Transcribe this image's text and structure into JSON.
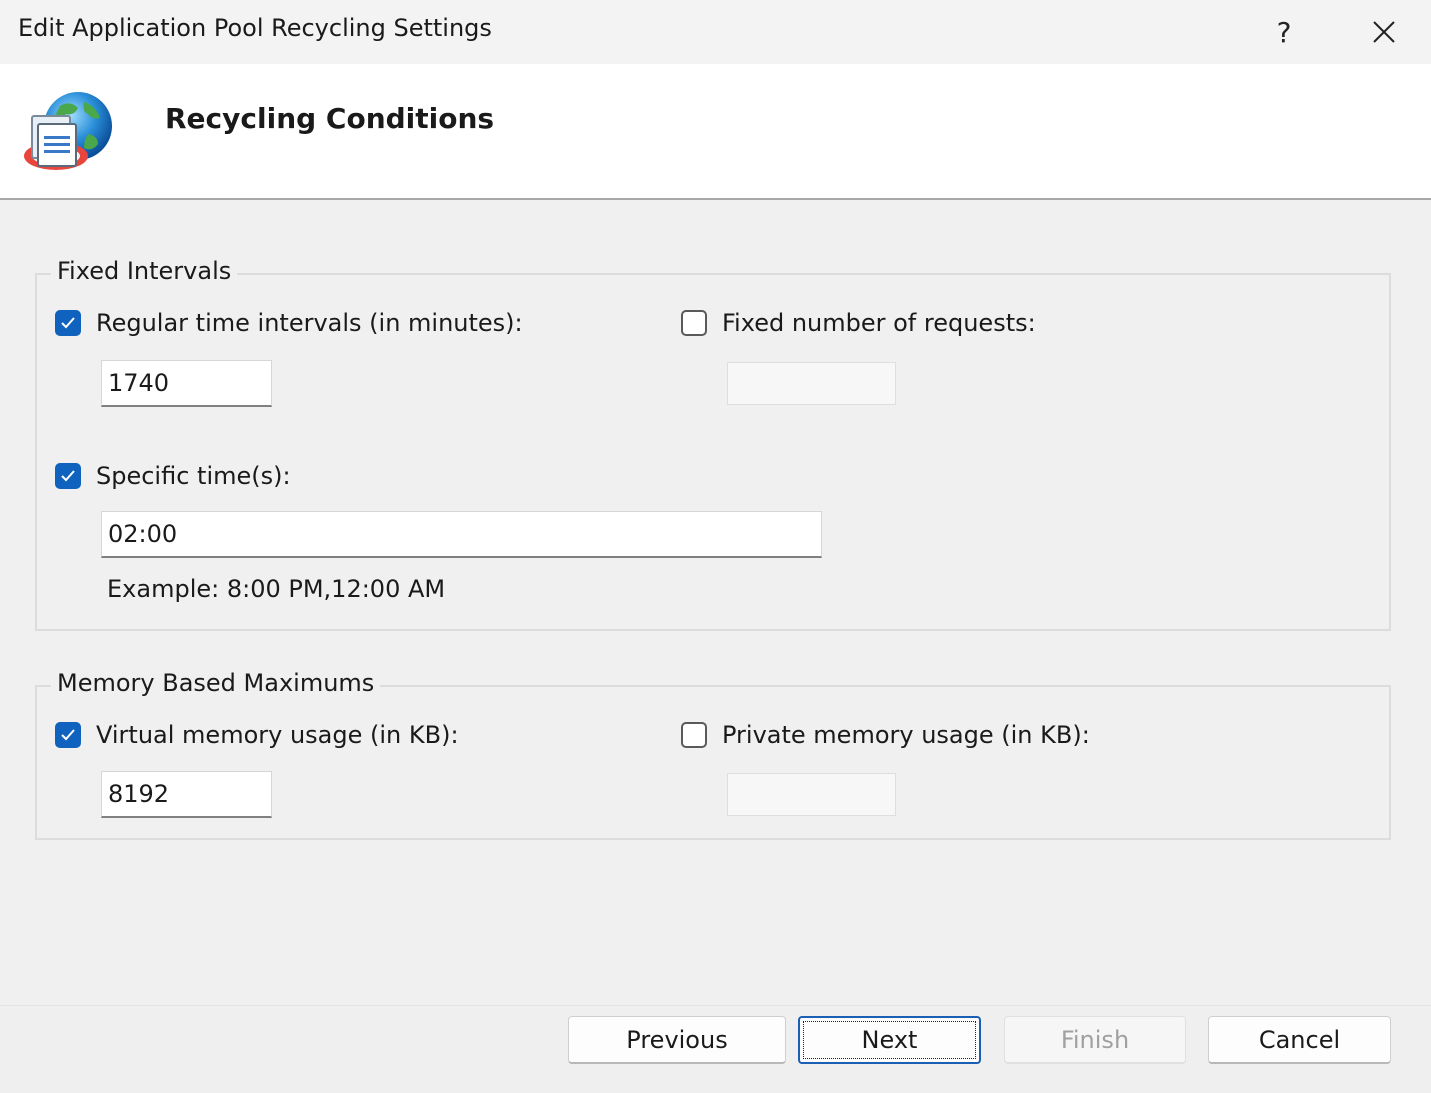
{
  "window": {
    "title": "Edit Application Pool Recycling Settings",
    "help_label": "?",
    "close_label": "✕"
  },
  "header": {
    "title": "Recycling Conditions",
    "icon": "application-pool-globe-icon"
  },
  "fixed_intervals": {
    "legend": "Fixed Intervals",
    "regular_time": {
      "label": "Regular time intervals (in minutes):",
      "checked": true,
      "value": "1740"
    },
    "fixed_requests": {
      "label": "Fixed number of requests:",
      "checked": false,
      "value": ""
    },
    "specific_times": {
      "label": "Specific time(s):",
      "checked": true,
      "value": "02:00"
    },
    "example": "Example: 8:00 PM,12:00 AM"
  },
  "memory": {
    "legend": "Memory Based Maximums",
    "virtual": {
      "label": "Virtual memory usage (in KB):",
      "checked": true,
      "value": "8192"
    },
    "private": {
      "label": "Private memory usage (in KB):",
      "checked": false,
      "value": ""
    }
  },
  "buttons": {
    "previous": "Previous",
    "next": "Next",
    "finish": "Finish",
    "cancel": "Cancel"
  },
  "colors": {
    "accent": "#0f62be",
    "header_bg": "#ffffff",
    "body_bg": "#f0f0f0"
  }
}
